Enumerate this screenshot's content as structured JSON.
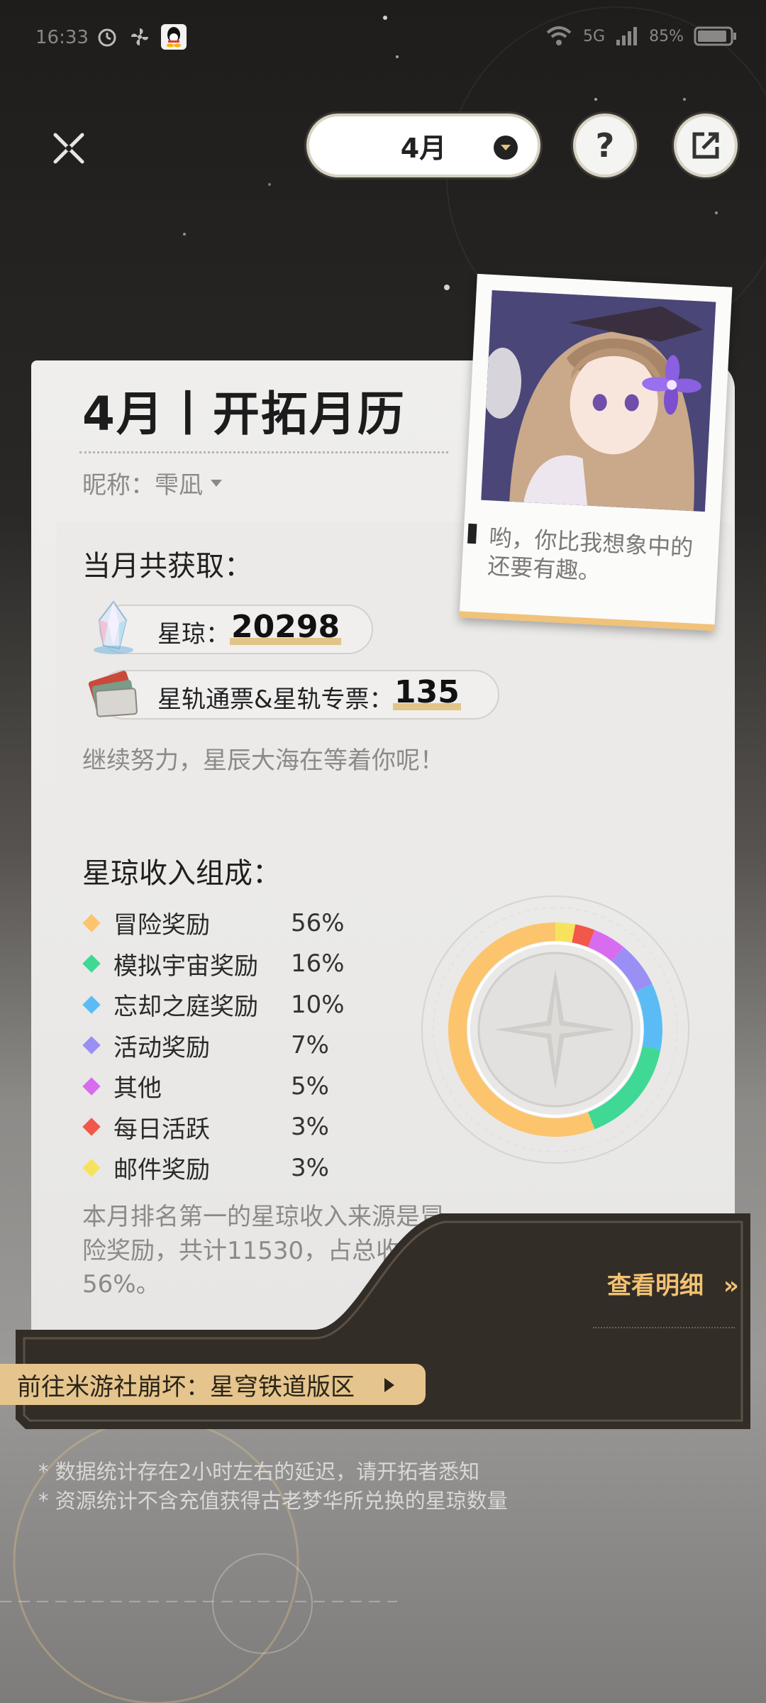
{
  "status_bar": {
    "time": "16:33",
    "network": "5G",
    "battery": "85%"
  },
  "header": {
    "month": "4月",
    "help_label": "?",
    "close_icon": "close-icon",
    "share_icon": "share-icon"
  },
  "card": {
    "title": "4月丨开拓月历",
    "nickname_label": "昵称：",
    "nickname": "雫凪",
    "obtained_heading": "当月共获取：",
    "stellar_jade_label": "星琼：",
    "stellar_jade_value": "20298",
    "pass_label": "星轨通票&星轨专票：",
    "pass_value": "135",
    "encourage": "继续努力，星辰大海在等着你呢！",
    "polaroid_quote": "哟，你比我想象中的还要有趣。"
  },
  "income": {
    "heading": "星琼收入组成：",
    "summary": "本月排名第一的星琼收入来源是冒险奖励，共计11530，占总收入的56%。"
  },
  "chart_data": {
    "type": "pie",
    "categories": [
      "冒险奖励",
      "模拟宇宙奖励",
      "忘却之庭奖励",
      "活动奖励",
      "其他",
      "每日活跃",
      "邮件奖励"
    ],
    "values": [
      56,
      16,
      10,
      7,
      5,
      3,
      3
    ],
    "labels": [
      "56%",
      "16%",
      "10%",
      "7%",
      "5%",
      "3%",
      "3%"
    ],
    "colors": [
      "#fcc46d",
      "#3fd895",
      "#5bbcf5",
      "#9a8ff5",
      "#d86cf0",
      "#f2574c",
      "#f7e25d"
    ]
  },
  "footer": {
    "detail_link": "查看明细",
    "detail_arrow": "»",
    "goto_label": "前往米游社崩坏：星穹铁道版区",
    "note1": "* 数据统计存在2小时左右的延迟，请开拓者悉知",
    "note2": "* 资源统计不含充值获得古老梦华所兑换的星琼数量"
  }
}
